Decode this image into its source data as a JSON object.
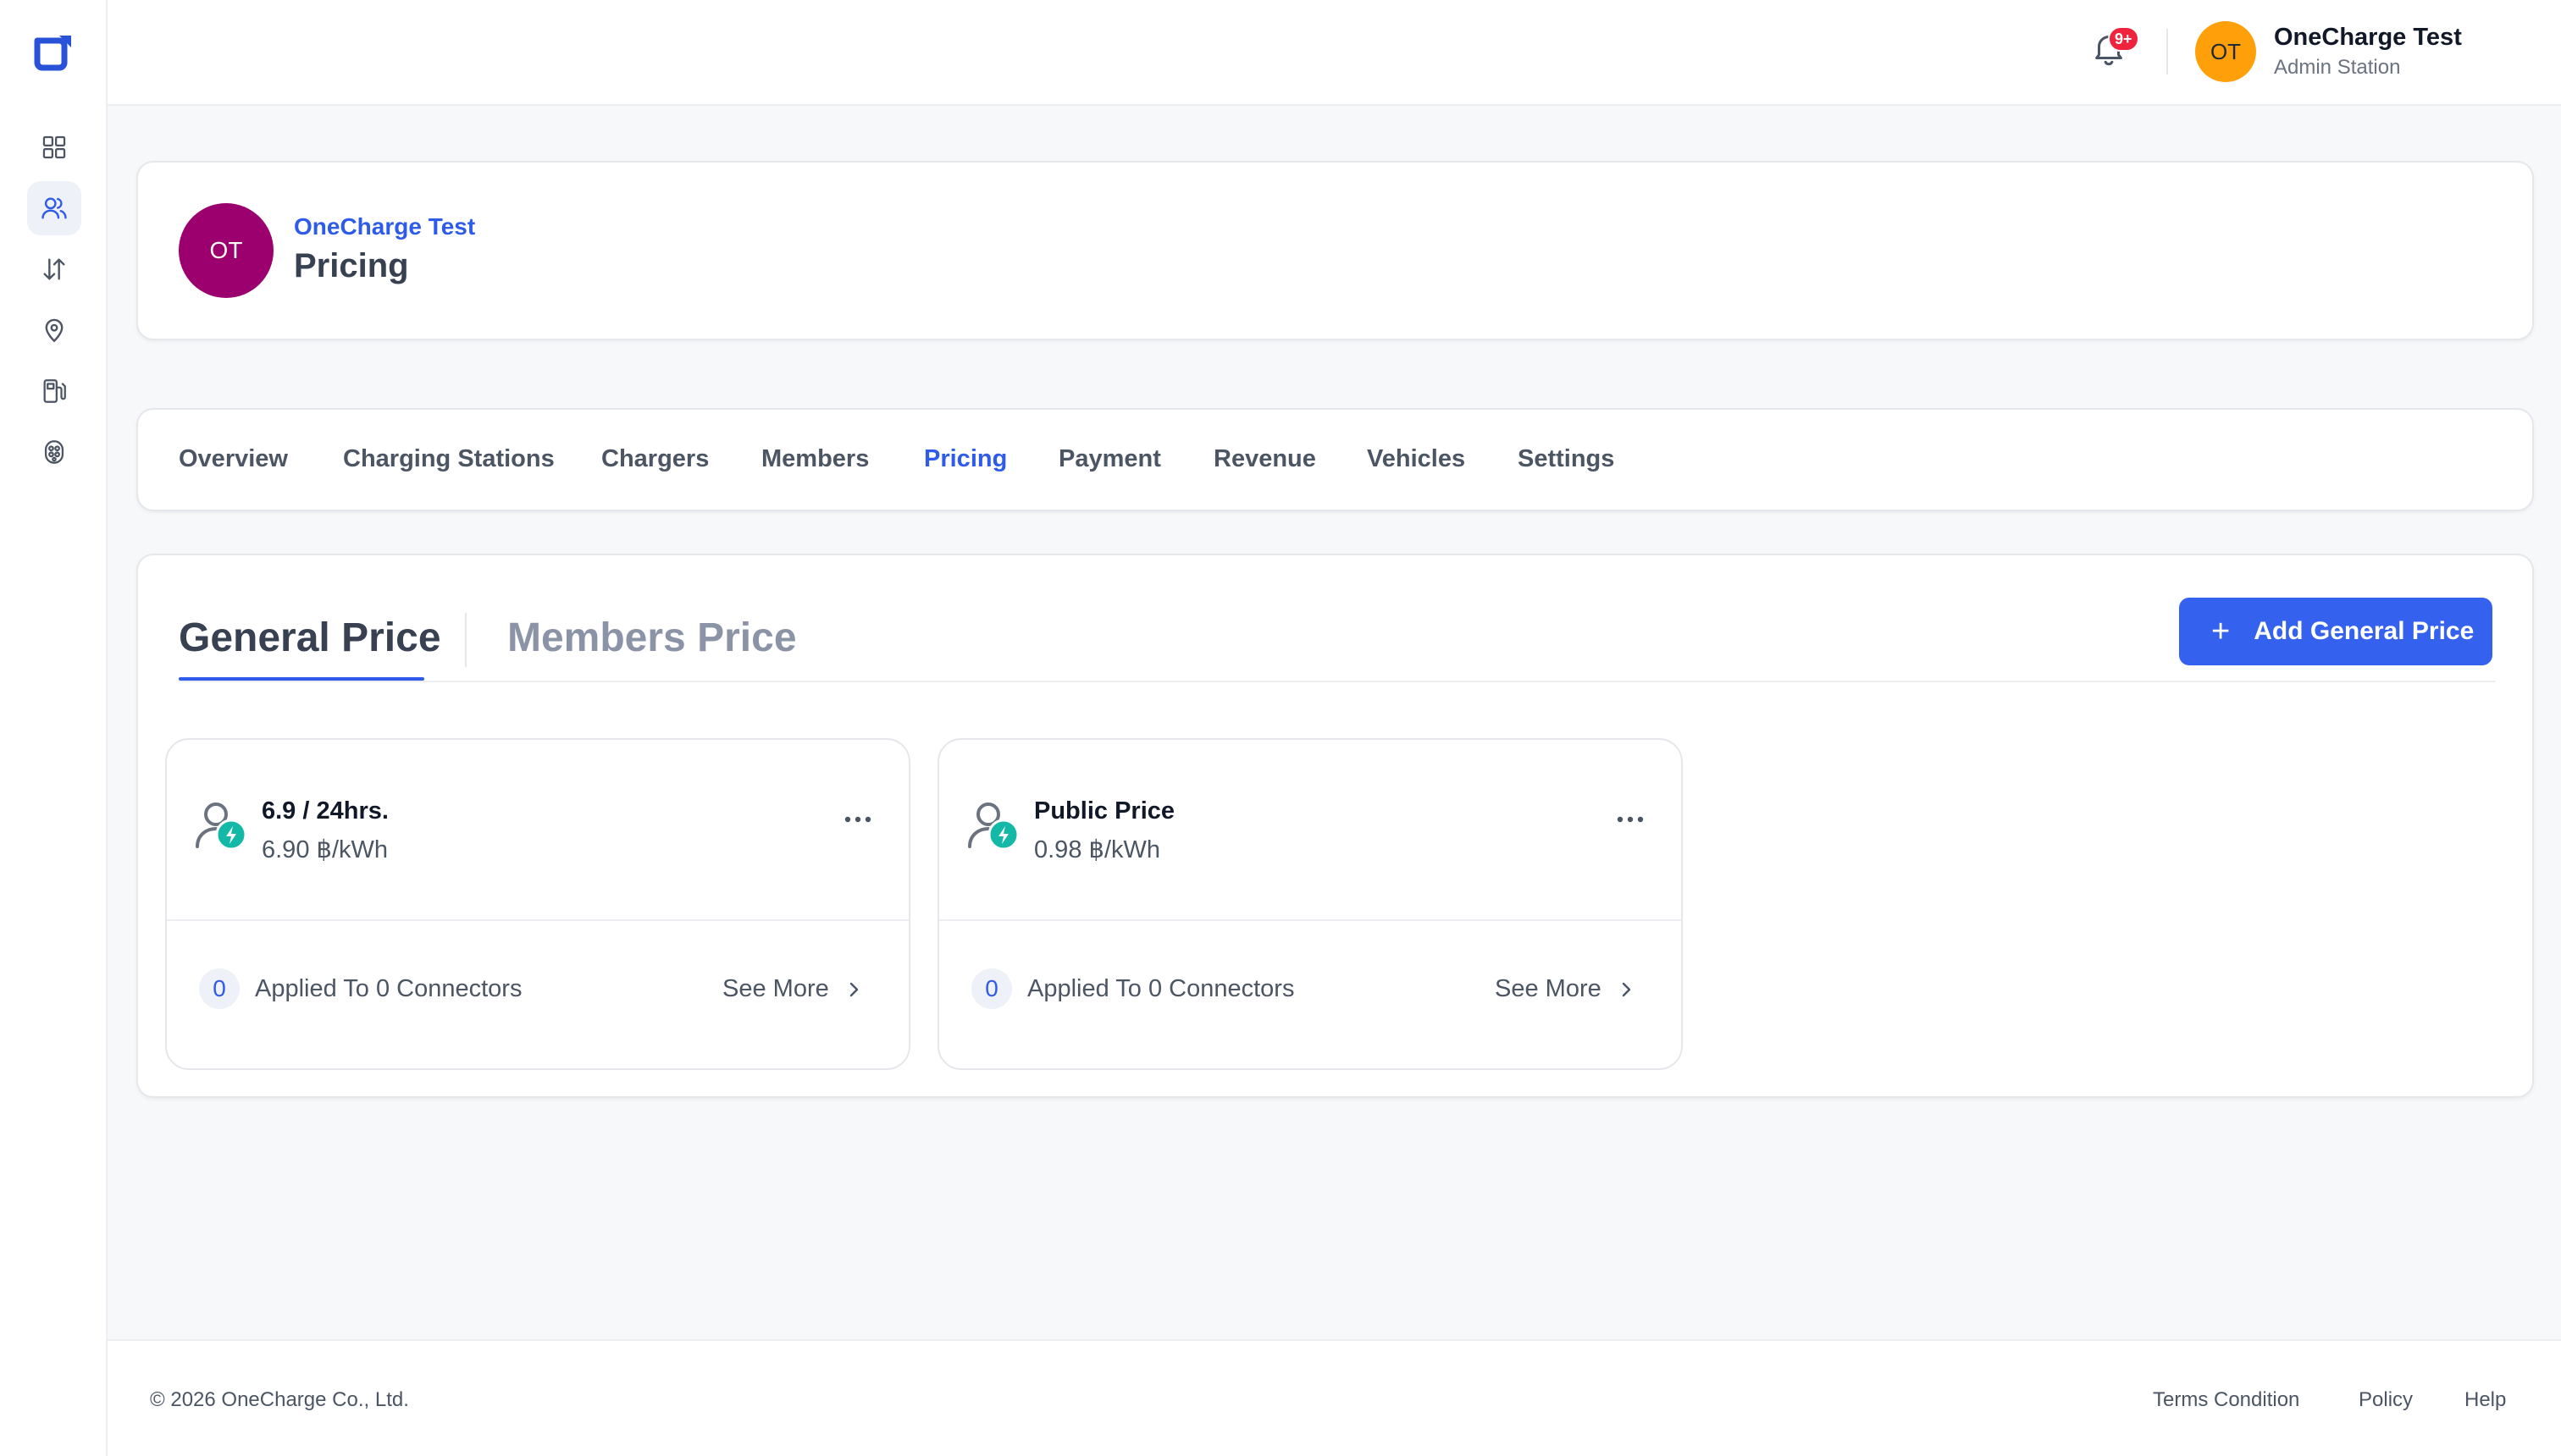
{
  "sidebar": {
    "items": [
      {
        "icon": "grid-icon"
      },
      {
        "icon": "users-icon"
      },
      {
        "icon": "transfer-icon"
      },
      {
        "icon": "map-pin-icon"
      },
      {
        "icon": "fuel-station-icon"
      },
      {
        "icon": "plug-icon"
      }
    ]
  },
  "topbar": {
    "notification_badge": "9+",
    "user_initials": "OT",
    "user_name": "OneCharge Test",
    "user_role": "Admin Station"
  },
  "header": {
    "avatar_initials": "OT",
    "org_name": "OneCharge Test",
    "title": "Pricing"
  },
  "tabs": [
    {
      "label": "Overview"
    },
    {
      "label": "Charging Stations"
    },
    {
      "label": "Chargers"
    },
    {
      "label": "Members"
    },
    {
      "label": "Pricing"
    },
    {
      "label": "Payment"
    },
    {
      "label": "Revenue"
    },
    {
      "label": "Vehicles"
    },
    {
      "label": "Settings"
    }
  ],
  "active_tab": "Pricing",
  "pricing": {
    "subtabs": [
      "General Price",
      "Members Price"
    ],
    "active_subtab": "General Price",
    "add_button_label": "Add General Price",
    "cards": [
      {
        "name": "6.9 / 24hrs.",
        "rate": "6.90 ฿/kWh",
        "count": "0",
        "applied": "Applied To 0 Connectors",
        "see_more": "See More"
      },
      {
        "name": "Public Price",
        "rate": "0.98 ฿/kWh",
        "count": "0",
        "applied": "Applied To 0 Connectors",
        "see_more": "See More"
      }
    ]
  },
  "footer": {
    "copyright": "© 2026 OneCharge Co., Ltd.",
    "links": [
      "Terms Condition",
      "Policy",
      "Help"
    ]
  },
  "colors": {
    "accent": "#2f5bea",
    "button": "#3461ee",
    "org_avatar": "#9c006e",
    "user_avatar": "#ff9f0a",
    "badge": "#ef233c",
    "status_green": "#14b8a6"
  }
}
